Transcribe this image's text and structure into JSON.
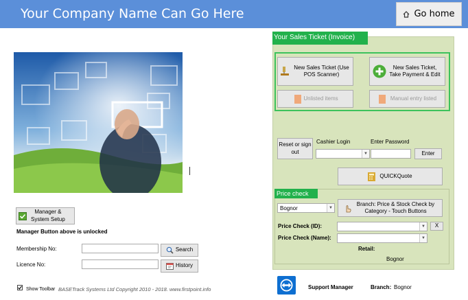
{
  "header": {
    "company_title": "Your Company Name Can Go Here",
    "go_home_label": "Go home"
  },
  "left": {
    "manager_button_label": "Manager &\nSystem Setup",
    "manager_status_text": "Manager Button above is unlocked",
    "membership_label": "Membership No:",
    "membership_value": "",
    "search_label": "Search",
    "licence_label": "Licence No:",
    "licence_value": "",
    "history_label": "History",
    "show_toolbar_label": "Show Toolbar",
    "show_toolbar_checked": true,
    "copyright_text": "BASETrack Systems Ltd Copyright 2010 - 2018.  www.firstpoint.info"
  },
  "sales": {
    "title": "Your Sales Ticket (Invoice)",
    "new_pos_label": "New Sales Ticket (Use POS Scanner)",
    "new_payment_label": "New Sales Ticket, Take Payment & Edit",
    "unlisted_label": "Unlisted items",
    "manual_label": "Manual entry listed"
  },
  "login": {
    "reset_label": "Reset or sign out",
    "cashier_label": "Cashier Login",
    "cashier_value": "",
    "password_label": "Enter Password",
    "password_value": "",
    "enter_label": "Enter",
    "quickquote_label": "QUICKQuote"
  },
  "price_check": {
    "title": "Price check",
    "branch_select_value": "Bognor",
    "branch_button_label": "Branch: Price & Stock Check by Category - Touch Buttons",
    "id_label": "Price Check (ID):",
    "id_value": "",
    "clear_label": "X",
    "name_label": "Price Check (Name):",
    "name_value": "",
    "retail_label": "Retail:",
    "retail_value": "Bognor"
  },
  "footer": {
    "support_label": "Support Manager",
    "branch_label": "Branch:",
    "branch_value": "Bognor"
  },
  "colors": {
    "header_bg": "#5b8fd9",
    "panel_bg": "#d8e4bc",
    "accent_green": "#22b14c",
    "teamviewer_blue": "#0e6fd1"
  }
}
